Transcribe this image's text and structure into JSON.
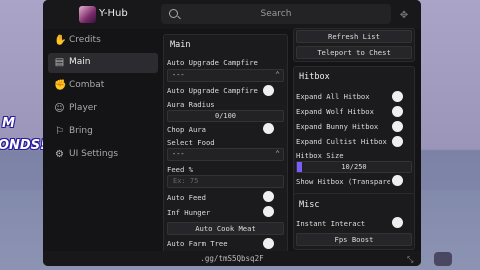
{
  "background": {
    "text_line_1": "M",
    "text_line_2": "ONDS!"
  },
  "window": {
    "title": "Y-Hub",
    "search_placeholder": "Search",
    "footer_text": ".gg/tmS5Qbsq2F"
  },
  "sidebar": {
    "items": [
      {
        "label": "Credits",
        "icon": "hand-icon"
      },
      {
        "label": "Main",
        "icon": "book-icon",
        "active": true
      },
      {
        "label": "Combat",
        "icon": "fist-icon"
      },
      {
        "label": "Player",
        "icon": "person-icon"
      },
      {
        "label": "Bring",
        "icon": "bag-icon"
      },
      {
        "label": "UI Settings",
        "icon": "gear-icon"
      }
    ]
  },
  "main": {
    "header": "Main",
    "auto_upgrade_label": "Auto Upgrade Campfire",
    "auto_upgrade_value": "---",
    "auto_upgrade_toggle": "Auto Upgrade Campfire",
    "aura_radius_label": "Aura Radius",
    "aura_radius_value": "0/100",
    "aura_radius_fraction": 0,
    "chop_aura": "Chop Aura",
    "select_food_label": "Select Food",
    "select_food_value": "---",
    "feed_label": "Feed %",
    "feed_placeholder": "Ex: 75",
    "auto_feed": "Auto Feed",
    "inf_hunger": "Inf Hunger",
    "auto_cook_meat": "Auto Cook Meat",
    "auto_farm_tree": "Auto Farm Tree"
  },
  "right_top": {
    "refresh_list": "Refresh List",
    "teleport_to_chest": "Teleport to Chest"
  },
  "hitbox": {
    "header": "Hitbox",
    "expand_all": "Expand All Hitbox",
    "expand_wolf": "Expand Wolf Hitbox",
    "expand_bunny": "Expand Bunny Hitbox",
    "expand_cultist": "Expand Cultist Hitbox",
    "size_label": "Hitbox Size",
    "size_value": "10/250",
    "size_fraction": 0.04,
    "show_hitbox": "Show Hitbox (Transparency)"
  },
  "misc": {
    "header": "Misc",
    "instant_interact": "Instant Interact",
    "fps_boost": "Fps Boost"
  },
  "colors": {
    "accent": "#7a5cff",
    "panel": "#1b1b1e",
    "window": "#141416"
  }
}
